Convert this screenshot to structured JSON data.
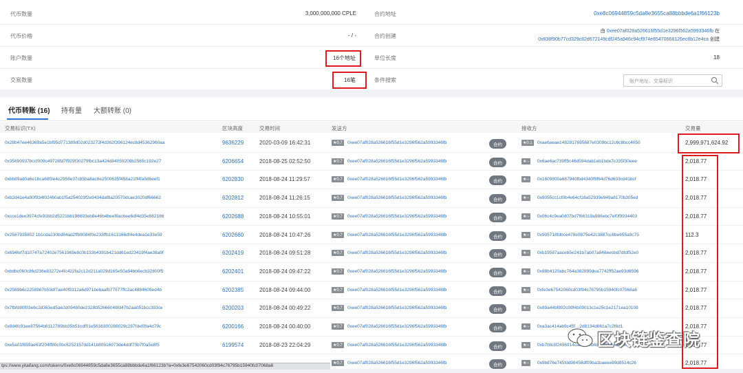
{
  "summary": {
    "supply_label": "代币数量",
    "supply_value": "3,000,000,000 CPLE",
    "contract_label": "合约地址",
    "contract_value": "0xe8c06944859c5da8e3655ca88bbbde6a1f66123b",
    "price_label": "代币价格",
    "price_value": "- / -",
    "creation_label": "合约创建",
    "creation_prefix": "由",
    "creation_creator": "0xee07af028a526616f55d1e3296f562a5993346fb",
    "creation_mid": "在",
    "creation_tx": "0x838f90b77cd329c82d672149cdf245a946c94cf974e85470668126ec8b12e4ca",
    "creation_suffix": "创建",
    "holders_label": "账户数量",
    "holders_value": "16个地址",
    "decimals_label": "单位长度",
    "decimals_value": "18",
    "transfers_label": "交易数量",
    "transfers_value": "16笔",
    "filter_label": "条件搜索",
    "search_placeholder": "账户地址、交易标识",
    "search_icon": "search-icon"
  },
  "tabs": [
    {
      "label": "代币转账 (16)",
      "active": true
    },
    {
      "label": "持有量",
      "active": false
    },
    {
      "label": "大额转账 (0)",
      "active": false
    }
  ],
  "table": {
    "headers": [
      "交易标识(TX)",
      "区块高度",
      "交易时间",
      "发送方",
      "接收方",
      "交易量"
    ],
    "contract_tag": "合约",
    "rows": [
      {
        "tx": "0x28b47ee46369a5e1bf95d771389d02d023273f4d362f396124ec8d45362960aa",
        "block": "9636229",
        "time": "2020-03-09 16:42:31",
        "from_badge": "★0.7",
        "from": "0xee07af028a526616f55d1e3296f562a5993346fb",
        "to_badge": "★0.1",
        "to": "0xae6aeae1482817695687e0309bc12c6c8bcc4050",
        "qty": "2,999,971,624.92"
      },
      {
        "tx": "0x35690937bccf009c49728fd7f929f30279fbc13a424d84059208b2565c192e27",
        "block": "6206654",
        "time": "2018-08-25 02:52:50",
        "from_badge": "★0.7",
        "from": "0xee07af028a526616f55d1e3296f562a5993346fb",
        "to_badge": "★--",
        "to": "0x6ae6ac739ff5c46d594dab1eb1bde7c335f30eee",
        "qty": "2,018.77"
      },
      {
        "tx": "0xbb89ad0a6e1bca68f3e4c2958e37c85ba8ac8e2500635f458a21ff4fa9d6eef1",
        "block": "6202830",
        "time": "2018-08-24 11:29:57",
        "from_badge": "★0.7",
        "from": "0xee07af028a526616f55d1e3296f562a5993346fb",
        "to_badge": "★--",
        "to": "0x1609800a687940fbd4340f9f64d76d603cd41bcf",
        "qty": "2,018.77"
      },
      {
        "tx": "0xb2d41e4a90f934f02460ab1f5a254029f2e9434daf8a20570dcae3020df66662",
        "block": "6202812",
        "time": "2018-08-24 11:26:15",
        "from_badge": "★0.7",
        "from": "0xee07af028a526616f55d1e3296f562a5993346fb",
        "to_badge": "★--",
        "to": "0x9055cc1cf0b4e64cf18a52939e949a8170b305ed",
        "qty": "2,018.77"
      },
      {
        "tx": "0xcce1dee3974cfe91bb2d5221bb198693eb8e46b4beef8acbee6df4d35e882186",
        "block": "6202688",
        "time": "2018-08-24 10:55:01",
        "from_badge": "★0.7",
        "from": "0xee07af028a526616f55d1e3296f562a5993346fb",
        "to_badge": "★--",
        "to": "0x06c4c9ea0d07bd7f66319a986ebc7ef0f9934403",
        "qty": "2,018.77"
      },
      {
        "tx": "0x2567935802 1b1cda230bd84ad2ffb8084f0e233ffb1613166df4e4dea1e33e59",
        "block": "6202660",
        "time": "2018-08-24 10:47:26",
        "from_badge": "★0.7",
        "from": "0xee07af028a526616f55d1e3296f562a5993346fb",
        "to_badge": "★--",
        "to": "0x905718fdbce478e0875e42c3887cc6be655a9c75",
        "qty": "112.3"
      },
      {
        "tx": "0x694fef7d10747a72402e7561969e8c0b133b4391b421dd61ed23419f4ae38a9f",
        "block": "6202419",
        "time": "2018-08-24 09:51:28",
        "from_badge": "★0.7",
        "from": "0xee07af028a526616f55d1e3296f562a5993346fb",
        "to_badge": "★--",
        "to": "0xb19587aaceb5e241b7ab07a848eecbd7dfdf52e0",
        "qty": "2,018.77"
      },
      {
        "tx": "0xbdbc060c86d236e83272e4fc422fa2c12d211a029d165e50a94bb6ecb32800f5",
        "block": "6202401",
        "time": "2018-08-24 09:47:22",
        "from_badge": "★0.7",
        "from": "0xee07af028a526616f55d1e3296f562a5993346fb",
        "to_badge": "★--",
        "to": "0x88b4120abc764a382899dea7742ff52ae93d6596",
        "qty": "2,018.77"
      },
      {
        "tx": "0x2089b6c2258987b59df7ae40f9312a6d971bebaafb77577ffc2ac4884609ed4b",
        "block": "6202385",
        "time": "2018-08-24 09:44:00",
        "from_badge": "★0.7",
        "from": "0xee07af028a526616f55d1e3296f562a5993346fb",
        "to_badge": "★--",
        "to": "0xfe3e67542060cd03f94c76795b15940fc07068a6",
        "qty": "2,018.77"
      },
      {
        "tx": "0x7fbfd80f03e6c2d363ed5ae2d09480de2328b52666048fd47b2aa051bcc393ce",
        "block": "6200203",
        "time": "2018-08-24 00:49:22",
        "from_badge": "★0.7",
        "from": "0xee07af028a526616f55d1e3296f562a5993346fb",
        "to_badge": "★--",
        "to": "0x89a44bf892c09f4b09013c1e25c1e2171ea10108",
        "qty": "2,018.77"
      },
      {
        "tx": "0x8d4fc91ee87564b6112789bb35b51cdf01e5638300288029c287fdef0fa4d79c",
        "block": "6200166",
        "time": "2018-08-24 00:40:00",
        "from_badge": "★0.7",
        "from": "0xee07af028a526616f55d1e3296f562a5993346fb",
        "to_badge": "★--",
        "to": "0xa3ac414ab9c45f…2d8134d661a7c2f6d1",
        "qty": "2,018.77"
      },
      {
        "tx": "0xe5a01f859ae63f204ff80c0bc6252157dd141b80916973de4ddf70b7f0a5e8f5",
        "block": "6199574",
        "time": "2018-08-23 22:04:29",
        "from_badge": "★0.7",
        "from": "0xee07af028a526616f55d1e3296f562a5993346fb",
        "to_badge": "★--",
        "to": "0xb7bfe3f2496914cad1…ed4c8088514adc4f",
        "qty": "2,018.77"
      },
      {
        "tx": "",
        "block": "",
        "time": "",
        "from_badge": "★0.7",
        "from": "0xee07af028a526616f55d1e3296f562a5993346fb",
        "to_badge": "★--",
        "to": "0x9b876e745fdd98458df09ba1baeee99d8514c26",
        "qty": "2,018.77"
      }
    ]
  },
  "status_bar": "tps://www.yitaifang.com/tokens/0xe8c06944859c5da8e3655ca88bbbde6a1f66123b?a=0xfe3e67542060cd03f94c76795b15940fc07068a6",
  "watermark": {
    "text": "区块链鉴查院",
    "icon": "wechat-icon"
  }
}
